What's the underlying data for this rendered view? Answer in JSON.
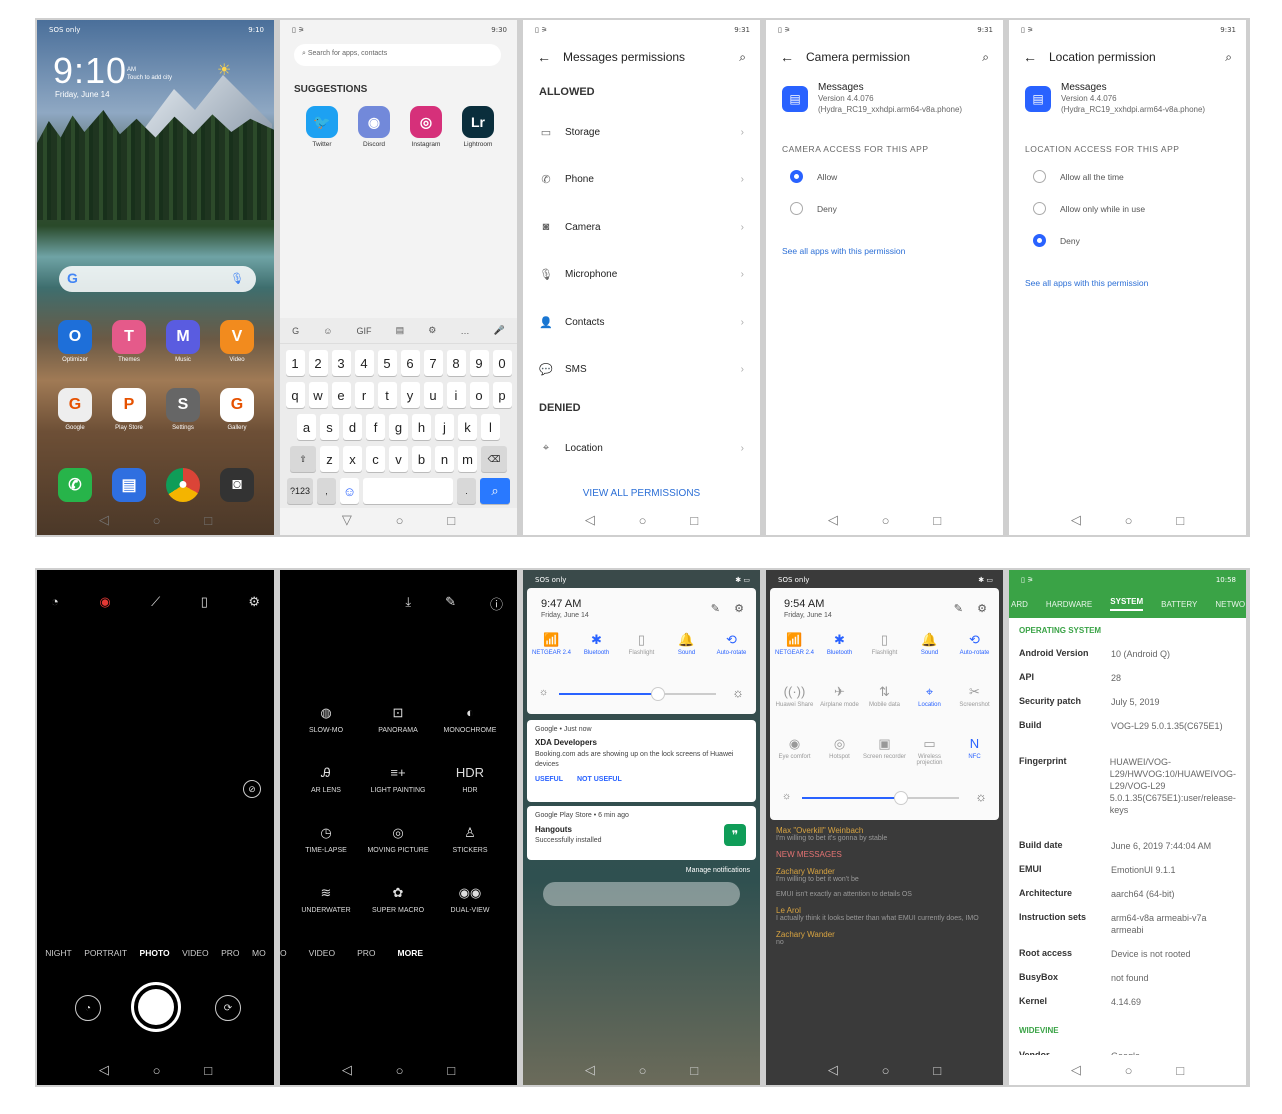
{
  "home": {
    "time": "9:10",
    "ampm": "AM",
    "touch": "Touch to add city",
    "date": "Friday, June 14",
    "status_left": "SOS only",
    "status_right": "9:10",
    "row1": [
      {
        "label": "Optimizer",
        "color": "#1e6fd9"
      },
      {
        "label": "Themes",
        "color": "#e55a8a"
      },
      {
        "label": "Music",
        "color": "#5a5ce0"
      },
      {
        "label": "Video",
        "color": "#f28b1e"
      }
    ],
    "row2": [
      {
        "label": "Google",
        "color": "#eeeeee"
      },
      {
        "label": "Play Store",
        "color": "#ffffff"
      },
      {
        "label": "Settings",
        "color": "#666666"
      },
      {
        "label": "Gallery",
        "color": "#ffffff"
      }
    ],
    "dock": [
      "Phone",
      "Messages",
      "Chrome",
      "Camera"
    ]
  },
  "search": {
    "status_right": "9:30",
    "placeholder": "Search for apps, contacts",
    "suggestions": "SUGGESTIONS",
    "apps": [
      {
        "label": "Twitter",
        "color": "#1da1f2",
        "glyph": "🐦"
      },
      {
        "label": "Discord",
        "color": "#7289da",
        "glyph": "◉"
      },
      {
        "label": "Instagram",
        "color": "#d6307a",
        "glyph": "◎"
      },
      {
        "label": "Lightroom",
        "color": "#0a2e3c",
        "glyph": "Lr"
      }
    ],
    "kb_top": [
      "G",
      "☺",
      "GIF",
      "▤",
      "⚙",
      "…",
      "🎤"
    ],
    "nums": [
      "1",
      "2",
      "3",
      "4",
      "5",
      "6",
      "7",
      "8",
      "9",
      "0"
    ],
    "r1": [
      "q",
      "w",
      "e",
      "r",
      "t",
      "y",
      "u",
      "i",
      "o",
      "p"
    ],
    "r2": [
      "a",
      "s",
      "d",
      "f",
      "g",
      "h",
      "j",
      "k",
      "l"
    ],
    "r3": [
      "z",
      "x",
      "c",
      "v",
      "b",
      "n",
      "m"
    ],
    "k_sym": "?123",
    "k_comma": ",",
    "k_period": "."
  },
  "perms": {
    "status_right": "9:31",
    "title": "Messages permissions",
    "allowed": "ALLOWED",
    "denied": "DENIED",
    "allowed_items": [
      {
        "label": "Storage",
        "icon": "▭"
      },
      {
        "label": "Phone",
        "icon": "✆"
      },
      {
        "label": "Camera",
        "icon": "◙"
      },
      {
        "label": "Microphone",
        "icon": "🎙"
      },
      {
        "label": "Contacts",
        "icon": "👤"
      },
      {
        "label": "SMS",
        "icon": "💬"
      }
    ],
    "denied_items": [
      {
        "label": "Location",
        "icon": "⌖"
      }
    ],
    "view_all": "VIEW ALL PERMISSIONS"
  },
  "camperm": {
    "status_right": "9:31",
    "title": "Camera permission",
    "app": "Messages",
    "version": "Version 4.4.076",
    "build": "(Hydra_RC19_xxhdpi.arm64-v8a.phone)",
    "section": "CAMERA ACCESS FOR THIS APP",
    "options": [
      "Allow",
      "Deny"
    ],
    "selected": 0,
    "see_all": "See all apps with this permission"
  },
  "locperm": {
    "status_right": "9:31",
    "title": "Location permission",
    "app": "Messages",
    "version": "Version 4.4.076",
    "build": "(Hydra_RC19_xxhdpi.arm64-v8a.phone)",
    "section": "LOCATION ACCESS FOR THIS APP",
    "options": [
      "Allow all the time",
      "Allow only while in use",
      "Deny"
    ],
    "selected": 2,
    "see_all": "See all apps with this permission"
  },
  "camera": {
    "top": [
      "◔",
      "◉",
      "⟋",
      "▯",
      "⚙"
    ],
    "modes": [
      "NIGHT",
      "PORTRAIT",
      "PHOTO",
      "VIDEO",
      "PRO",
      "MO"
    ],
    "active": "PHOTO"
  },
  "more": {
    "top": [
      "⤓",
      "✎",
      "ⓘ"
    ],
    "items": [
      {
        "label": "SLOW-MO",
        "icon": "◍"
      },
      {
        "label": "PANORAMA",
        "icon": "⊡"
      },
      {
        "label": "MONOCHROME",
        "icon": "◐"
      },
      {
        "label": "AR LENS",
        "icon": "Ꭿ"
      },
      {
        "label": "LIGHT PAINTING",
        "icon": "≡+"
      },
      {
        "label": "HDR",
        "icon": "HDR"
      },
      {
        "label": "TIME-LAPSE",
        "icon": "◷"
      },
      {
        "label": "MOVING PICTURE",
        "icon": "◎"
      },
      {
        "label": "STICKERS",
        "icon": "♙"
      },
      {
        "label": "UNDERWATER",
        "icon": "≋"
      },
      {
        "label": "SUPER MACRO",
        "icon": "✿"
      },
      {
        "label": "DUAL-VIEW",
        "icon": "◉◉"
      }
    ],
    "modes": [
      "O",
      "VIDEO",
      "PRO",
      "MORE"
    ],
    "active": "MORE"
  },
  "shade1": {
    "status_left": "SOS only",
    "time": "9:47 AM",
    "date": "Friday, June 14",
    "tiles": [
      {
        "label": "NETGEAR 2.4",
        "icon": "📶",
        "on": true
      },
      {
        "label": "Bluetooth",
        "icon": "✱",
        "on": true
      },
      {
        "label": "Flashlight",
        "icon": "▯",
        "on": false
      },
      {
        "label": "Sound",
        "icon": "🔔",
        "on": true
      },
      {
        "label": "Auto-rotate",
        "icon": "⟲",
        "on": true
      }
    ],
    "n1_app": "Google • Just now",
    "n1_title": "XDA Developers",
    "n1_text": "Booking.com ads are showing up on the lock screens of Huawei devices",
    "n1_a1": "USEFUL",
    "n1_a2": "NOT USEFUL",
    "n2_app": "Google Play Store • 6 min ago",
    "n2_title": "Hangouts",
    "n2_text": "Successfully installed",
    "manage": "Manage notifications"
  },
  "shade2": {
    "status_left": "SOS only",
    "time": "9:54 AM",
    "date": "Friday, June 14",
    "tiles": [
      {
        "label": "NETGEAR 2.4",
        "icon": "📶",
        "on": true
      },
      {
        "label": "Bluetooth",
        "icon": "✱",
        "on": true
      },
      {
        "label": "Flashlight",
        "icon": "▯",
        "on": false
      },
      {
        "label": "Sound",
        "icon": "🔔",
        "on": true
      },
      {
        "label": "Auto-rotate",
        "icon": "⟲",
        "on": true
      },
      {
        "label": "Huawei Share",
        "icon": "((·))",
        "on": false
      },
      {
        "label": "Airplane mode",
        "icon": "✈",
        "on": false
      },
      {
        "label": "Mobile data",
        "icon": "⇅",
        "on": false
      },
      {
        "label": "Location",
        "icon": "⌖",
        "on": true
      },
      {
        "label": "Screenshot",
        "icon": "✂",
        "on": false
      },
      {
        "label": "Eye comfort",
        "icon": "◉",
        "on": false
      },
      {
        "label": "Hotspot",
        "icon": "◎",
        "on": false
      },
      {
        "label": "Screen recorder",
        "icon": "▣",
        "on": false
      },
      {
        "label": "Wireless projection",
        "icon": "▭",
        "on": false
      },
      {
        "label": "NFC",
        "icon": "N",
        "on": true
      }
    ],
    "chat": [
      {
        "name": "Max \"Overkill\" Weinbach",
        "text": "I'm willing to bet it's gonna by stable"
      },
      {
        "name": "NEW MESSAGES",
        "text": ""
      },
      {
        "name": "Zachary Wander",
        "text": "I'm willing to bet it won't be"
      },
      {
        "name": "",
        "text": "EMUI isn't exactly an attention to details OS"
      },
      {
        "name": "Le Arol",
        "text": "I actually think it looks better than what EMUI currently does, IMO"
      },
      {
        "name": "Zachary Wander",
        "text": "no"
      }
    ]
  },
  "device": {
    "status_right": "10:58",
    "tabs": [
      "ARD",
      "HARDWARE",
      "SYSTEM",
      "BATTERY",
      "NETWO"
    ],
    "active": "SYSTEM",
    "section": "OPERATING SYSTEM",
    "rows": [
      {
        "k": "Android Version",
        "v": "10 (Android Q)"
      },
      {
        "k": "API",
        "v": "28"
      },
      {
        "k": "Security patch",
        "v": "July 5, 2019"
      },
      {
        "k": "Build",
        "v": "VOG-L29 5.0.1.35(C675E1)"
      },
      {
        "k": "Fingerprint",
        "v": "HUAWEI/VOG-L29/HWVOG:10/HUAWEIVOG-L29/VOG-L29 5.0.1.35(C675E1):user/release-keys"
      },
      {
        "k": "Build date",
        "v": "June 6, 2019 7:44:04 AM"
      },
      {
        "k": "EMUI",
        "v": "EmotionUI 9.1.1"
      },
      {
        "k": "Architecture",
        "v": "aarch64 (64-bit)"
      },
      {
        "k": "Instruction sets",
        "v": "arm64-v8a armeabi-v7a armeabi"
      },
      {
        "k": "Root access",
        "v": "Device is not rooted"
      },
      {
        "k": "BusyBox",
        "v": "not found"
      },
      {
        "k": "Kernel",
        "v": "4.14.69"
      }
    ],
    "section2": "WIDEVINE",
    "vendor_k": "Vendor",
    "vendor_v": "Google"
  },
  "nav": [
    "◁",
    "○",
    "□"
  ]
}
